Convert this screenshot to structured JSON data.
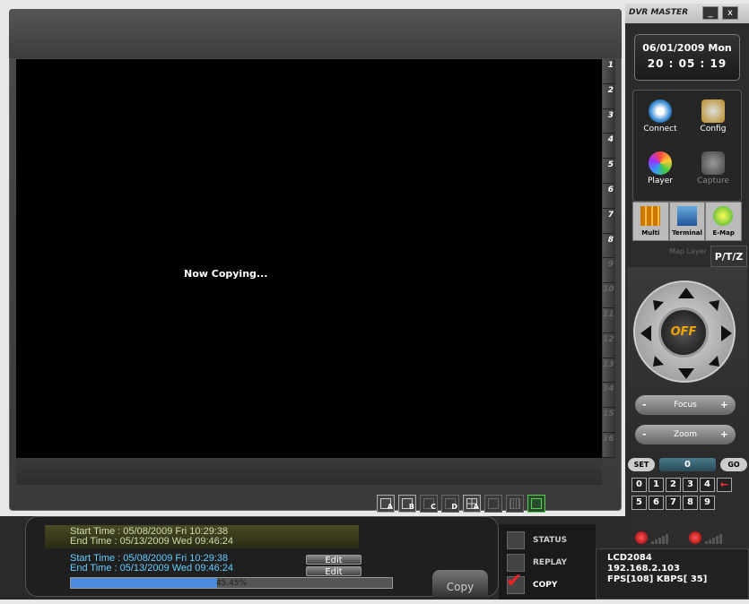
{
  "app": {
    "title": "DVR MASTER"
  },
  "window": {
    "minimize": "_",
    "close": "x"
  },
  "clock": {
    "date": "06/01/2009 Mon",
    "time": "20 : 05 : 19"
  },
  "toolbar": {
    "connect": "Connect",
    "config": "Config",
    "player": "Player",
    "capture": "Capture"
  },
  "view_tabs": {
    "multi": "Multi",
    "terminal": "Terminal",
    "emap": "E-Map"
  },
  "map_layer": "Map Layer",
  "ptz": {
    "label": "P/T/Z",
    "off": "OFF",
    "focus": "Focus",
    "zoom": "Zoom",
    "minus": "-",
    "plus": "+"
  },
  "preset": {
    "set": "SET",
    "value": "0",
    "go": "GO"
  },
  "keypad": {
    "row1": [
      "0",
      "1",
      "2",
      "3",
      "4"
    ],
    "row2": [
      "5",
      "6",
      "7",
      "8",
      "9"
    ],
    "back": "←"
  },
  "channels": [
    "1",
    "2",
    "3",
    "4",
    "5",
    "6",
    "7",
    "8",
    "9",
    "10",
    "11",
    "12",
    "13",
    "14",
    "15",
    "16"
  ],
  "video": {
    "status": "Now Copying..."
  },
  "layouts": [
    "A",
    "B",
    "C",
    "D",
    "A",
    "",
    "",
    ""
  ],
  "time_source": {
    "start": "Start Time : 05/08/2009 Fri 10:29:38",
    "end": "End  Time : 05/13/2009 Wed 09:46:24"
  },
  "time_copy": {
    "start": "Start Time : 05/08/2009 Fri 10:29:38",
    "end": "End  Time : 05/13/2009 Wed 09:46:24",
    "edit": "Edit"
  },
  "progress": {
    "value": 45.45,
    "label": "45.45%"
  },
  "copy_button": "Copy",
  "modes": {
    "status": "STATUS",
    "replay": "REPLAY",
    "copy": "COPY"
  },
  "info": {
    "model": "LCD2084",
    "ip": "192.168.2.103",
    "fps": "FPS[108]  KBPS[ 35]"
  },
  "colors": {
    "progress": "#4d8be0",
    "offtext": "#f5a400"
  }
}
